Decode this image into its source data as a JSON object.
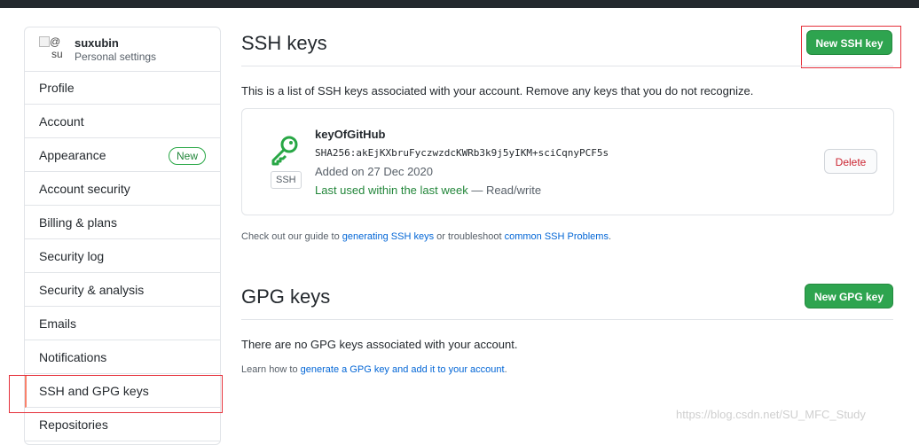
{
  "user": {
    "name": "suxubin",
    "subtitle": "Personal settings",
    "avatar_alt_at": "@",
    "avatar_alt_su": "su"
  },
  "sidebar": {
    "items": [
      {
        "label": "Profile"
      },
      {
        "label": "Account"
      },
      {
        "label": "Appearance",
        "badge": "New"
      },
      {
        "label": "Account security"
      },
      {
        "label": "Billing & plans"
      },
      {
        "label": "Security log"
      },
      {
        "label": "Security & analysis"
      },
      {
        "label": "Emails"
      },
      {
        "label": "Notifications"
      },
      {
        "label": "SSH and GPG keys",
        "selected": true
      },
      {
        "label": "Repositories"
      }
    ]
  },
  "ssh": {
    "title": "SSH keys",
    "new_button": "New SSH key",
    "intro": "This is a list of SSH keys associated with your account. Remove any keys that you do not recognize.",
    "key": {
      "tag": "SSH",
      "icon": "key-icon",
      "title": "keyOfGitHub",
      "fingerprint": "SHA256:akEjKXbruFyczwzdcKWRb3k9j5yIKM+sciCqnyPCF5s",
      "added": "Added on 27 Dec 2020",
      "last_used": "Last used within the last week",
      "access": " — Read/write",
      "delete_label": "Delete"
    },
    "guide": {
      "prefix": "Check out our guide to ",
      "link1": "generating SSH keys",
      "middle": " or troubleshoot ",
      "link2": "common SSH Problems",
      "suffix": "."
    }
  },
  "gpg": {
    "title": "GPG keys",
    "new_button": "New GPG key",
    "empty": "There are no GPG keys associated with your account.",
    "learn_prefix": "Learn how to ",
    "learn_link": "generate a GPG key and add it to your account",
    "learn_suffix": "."
  },
  "watermark": "https://blog.csdn.net/SU_MFC_Study",
  "colors": {
    "green": "#2ea44f",
    "link": "#0366d6",
    "danger": "#cb2431",
    "highlight_border": "#e5303a",
    "selected_accent": "#f9826c"
  }
}
